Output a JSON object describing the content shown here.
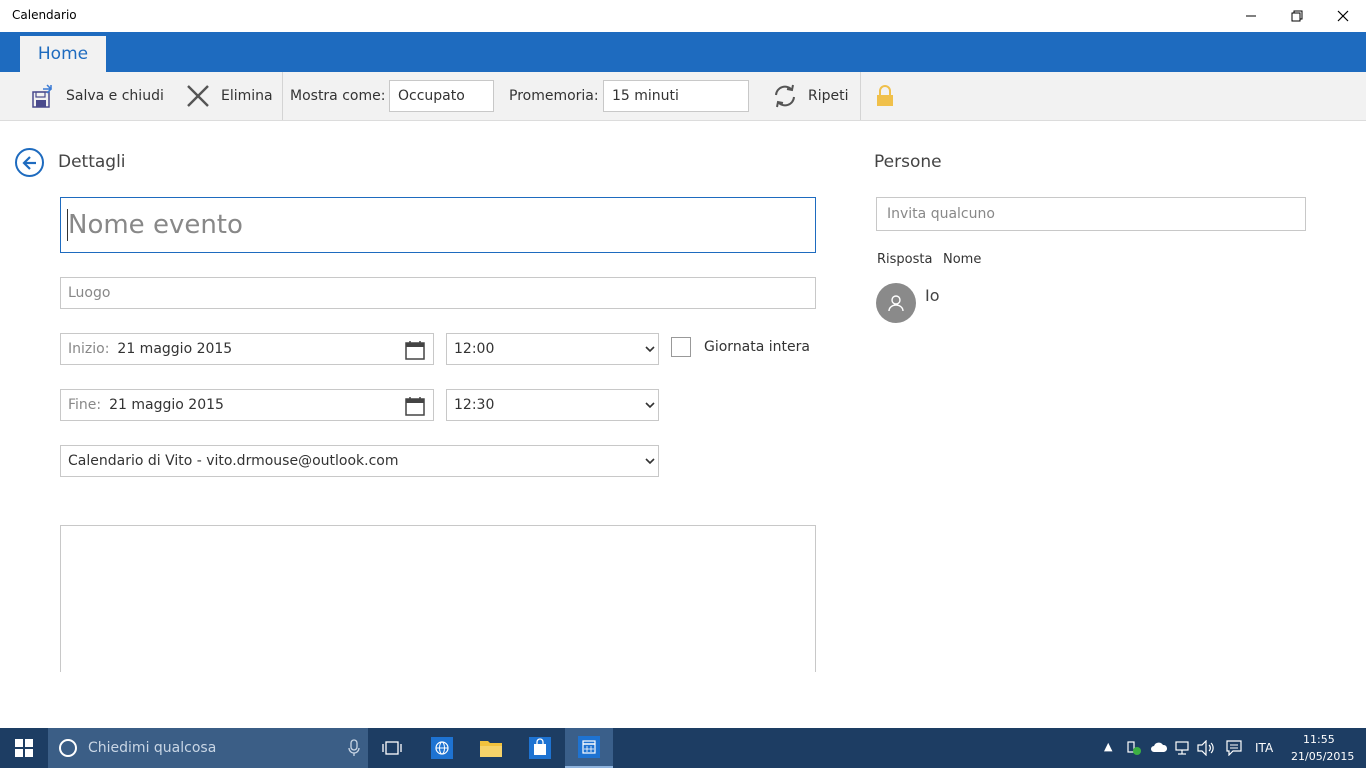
{
  "window": {
    "title": "Calendario",
    "minimize_glyph": "—",
    "maximize_glyph": "❐",
    "close_glyph": "✕"
  },
  "ribbon": {
    "tab_label": "Home"
  },
  "toolbar": {
    "save_label": "Salva e chiudi",
    "delete_label": "Elimina",
    "show_as_label": "Mostra come:",
    "show_as_value": "Occupato",
    "reminder_label": "Promemoria:",
    "reminder_value": "15 minuti",
    "repeat_label": "Ripeti"
  },
  "details": {
    "title": "Dettagli",
    "event_name_placeholder": "Nome evento",
    "location_placeholder": "Luogo",
    "start_label": "Inizio:",
    "start_date": "21 maggio 2015",
    "start_time": "12:00",
    "all_day_label": "Giornata intera",
    "end_label": "Fine:",
    "end_date": "21 maggio 2015",
    "end_time": "12:30",
    "calendar_value": "Calendario di Vito - vito.drmouse@outlook.com"
  },
  "people": {
    "title": "Persone",
    "invite_placeholder": "Invita qualcuno",
    "col_response": "Risposta",
    "col_name": "Nome",
    "attendees": [
      {
        "name": "Io"
      }
    ]
  },
  "taskbar": {
    "search_placeholder": "Chiedimi qualcosa",
    "language": "ITA",
    "time": "11:55",
    "date": "21/05/2015"
  },
  "colors": {
    "accent": "#1e6bbf",
    "taskbar": "#1d3d63"
  }
}
